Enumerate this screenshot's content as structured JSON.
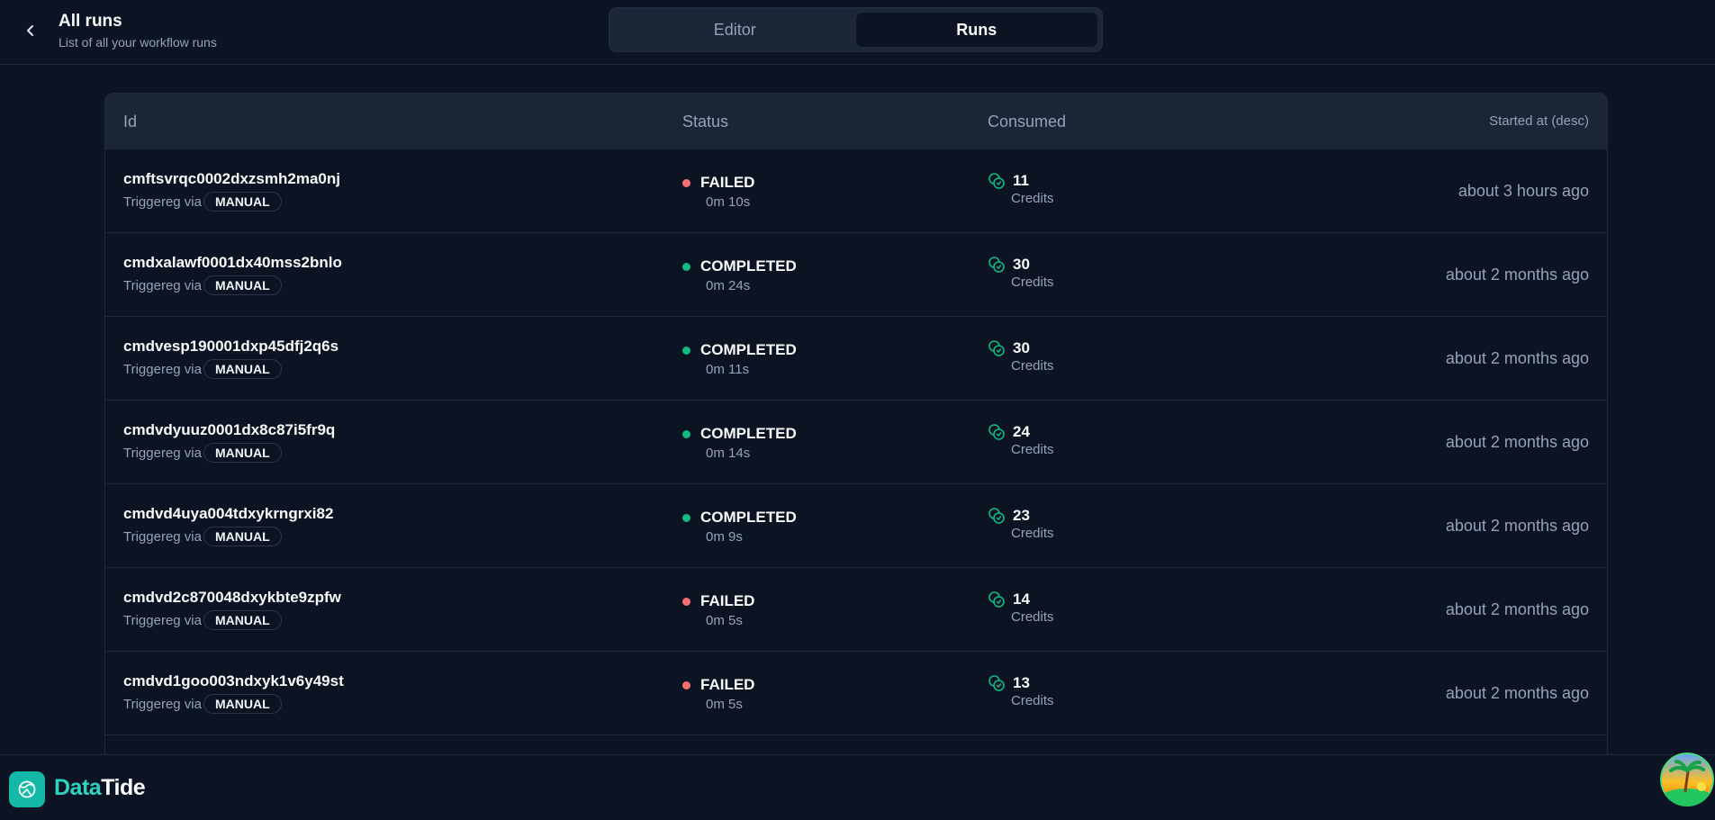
{
  "header": {
    "back_icon": "chevron-left-icon",
    "title": "All runs",
    "subtitle": "List of all your workflow runs",
    "tabs": [
      {
        "label": "Editor",
        "active": false
      },
      {
        "label": "Runs",
        "active": true
      }
    ]
  },
  "table": {
    "columns": {
      "id": "Id",
      "status": "Status",
      "consumed": "Consumed",
      "started": "Started at (desc)"
    },
    "rows": [
      {
        "id": "cmftsvrqc0002dxzsmh2ma0nj",
        "trigger_label": "Triggereg via",
        "trigger": "MANUAL",
        "status": "FAILED",
        "duration": "0m 10s",
        "credits": "11",
        "credits_unit": "Credits",
        "started": "about 3 hours ago"
      },
      {
        "id": "cmdxalawf0001dx40mss2bnlo",
        "trigger_label": "Triggereg via",
        "trigger": "MANUAL",
        "status": "COMPLETED",
        "duration": "0m 24s",
        "credits": "30",
        "credits_unit": "Credits",
        "started": "about 2 months ago"
      },
      {
        "id": "cmdvesp190001dxp45dfj2q6s",
        "trigger_label": "Triggereg via",
        "trigger": "MANUAL",
        "status": "COMPLETED",
        "duration": "0m 11s",
        "credits": "30",
        "credits_unit": "Credits",
        "started": "about 2 months ago"
      },
      {
        "id": "cmdvdyuuz0001dx8c87i5fr9q",
        "trigger_label": "Triggereg via",
        "trigger": "MANUAL",
        "status": "COMPLETED",
        "duration": "0m 14s",
        "credits": "24",
        "credits_unit": "Credits",
        "started": "about 2 months ago"
      },
      {
        "id": "cmdvd4uya004tdxykrngrxi82",
        "trigger_label": "Triggereg via",
        "trigger": "MANUAL",
        "status": "COMPLETED",
        "duration": "0m 9s",
        "credits": "23",
        "credits_unit": "Credits",
        "started": "about 2 months ago"
      },
      {
        "id": "cmdvd2c870048dxykbte9zpfw",
        "trigger_label": "Triggereg via",
        "trigger": "MANUAL",
        "status": "FAILED",
        "duration": "0m 5s",
        "credits": "14",
        "credits_unit": "Credits",
        "started": "about 2 months ago"
      },
      {
        "id": "cmdvd1goo003ndxyk1v6y49st",
        "trigger_label": "Triggereg via",
        "trigger": "MANUAL",
        "status": "FAILED",
        "duration": "0m 5s",
        "credits": "13",
        "credits_unit": "Credits",
        "started": "about 2 months ago"
      }
    ]
  },
  "footer": {
    "logo_icon": "datatide-logo-icon",
    "brand_part1": "Data",
    "brand_part2": "Tide",
    "avatar": "user-avatar"
  },
  "colors": {
    "background": "#0c1424",
    "accent": "#2dd4bf",
    "failed": "#f87171",
    "completed": "#10b981"
  }
}
